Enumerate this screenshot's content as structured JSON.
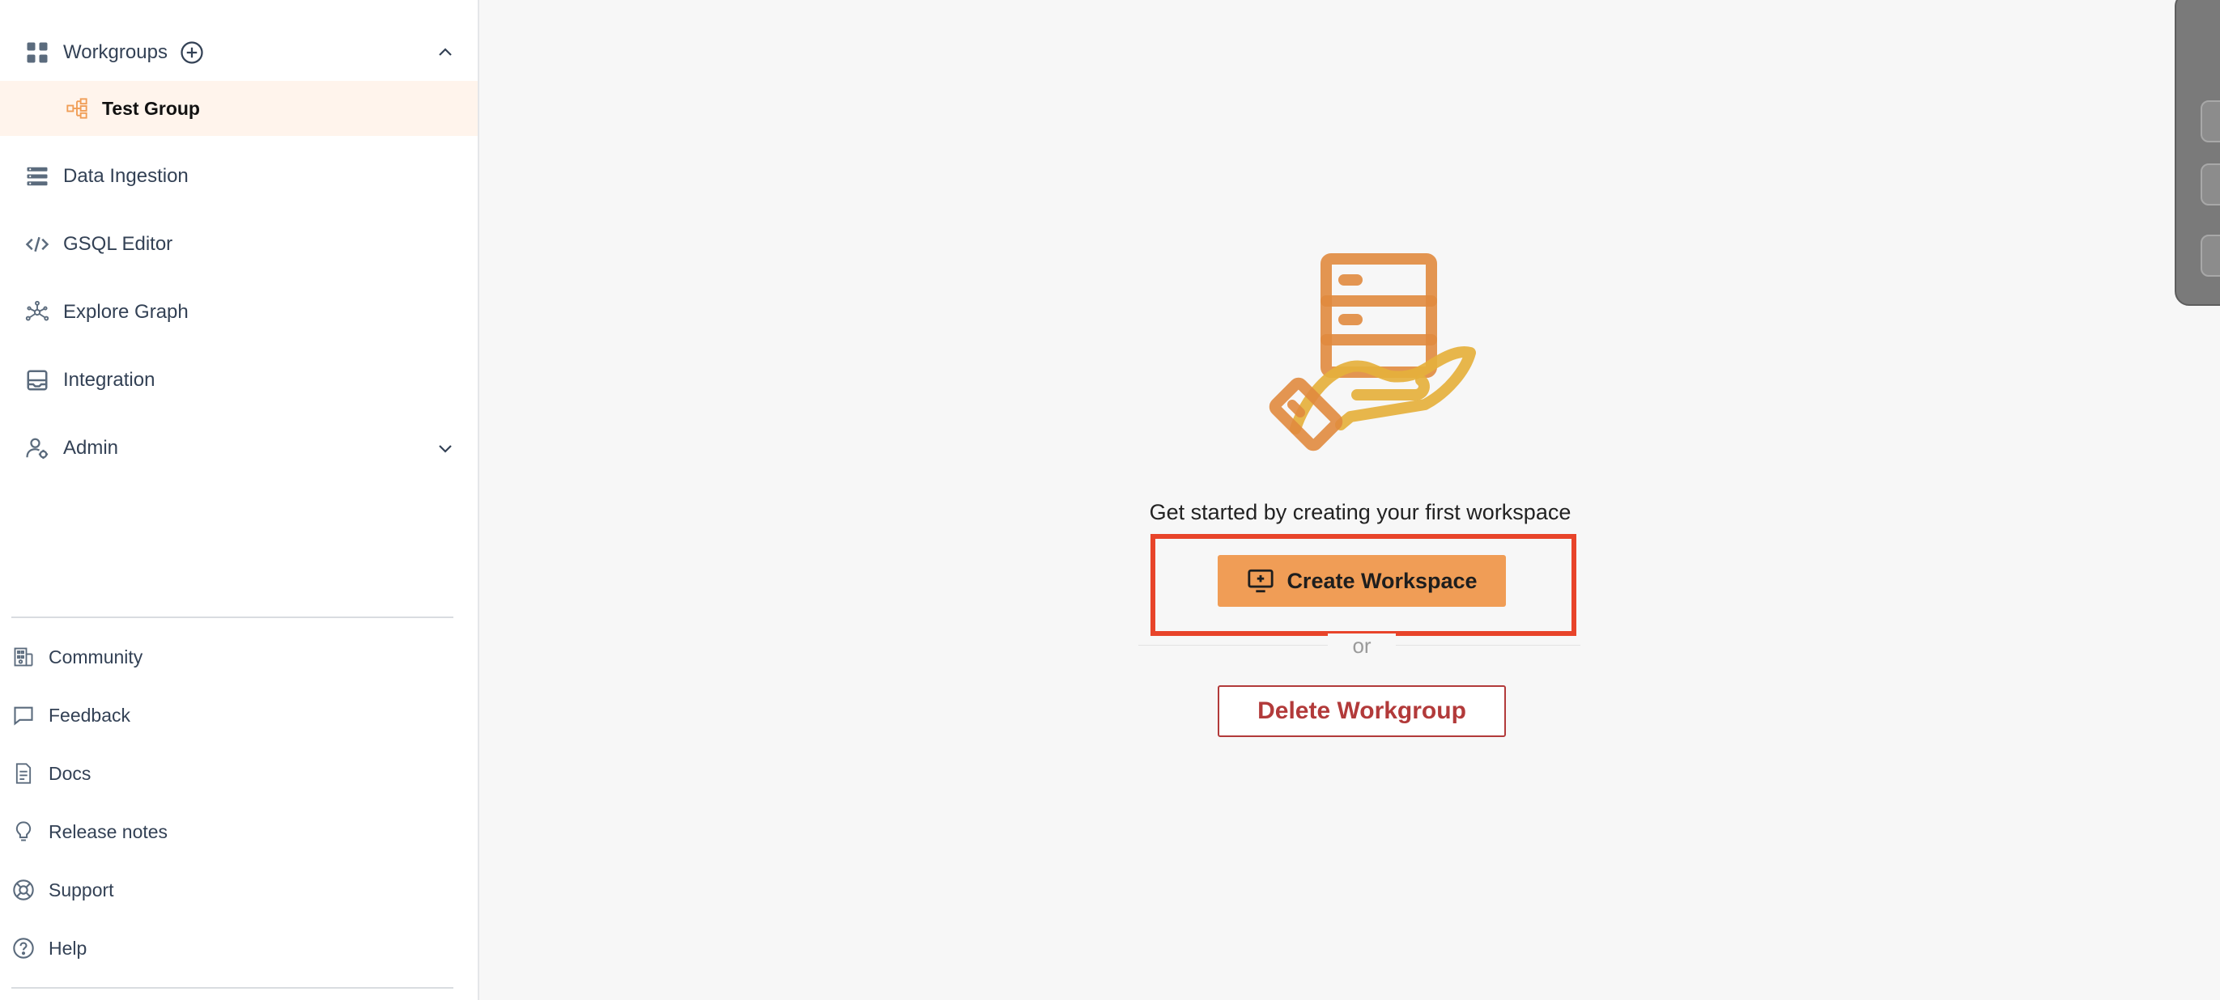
{
  "sidebar": {
    "workgroups": {
      "label": "Workgroups",
      "items": [
        {
          "label": "Test Group"
        }
      ]
    },
    "nav": [
      {
        "label": "Data Ingestion",
        "icon": "data-ingestion-icon"
      },
      {
        "label": "GSQL Editor",
        "icon": "code-icon"
      },
      {
        "label": "Explore Graph",
        "icon": "graph-icon"
      },
      {
        "label": "Integration",
        "icon": "integration-icon"
      },
      {
        "label": "Admin",
        "icon": "admin-icon"
      }
    ],
    "footer": [
      {
        "label": "Community",
        "icon": "community-icon"
      },
      {
        "label": "Feedback",
        "icon": "feedback-icon"
      },
      {
        "label": "Docs",
        "icon": "docs-icon"
      },
      {
        "label": "Release notes",
        "icon": "lightbulb-icon"
      },
      {
        "label": "Support",
        "icon": "support-icon"
      },
      {
        "label": "Help",
        "icon": "help-icon"
      }
    ]
  },
  "main": {
    "empty_message": "Get started by creating your first workspace",
    "create_button": "Create Workspace",
    "or_text": "or",
    "delete_button": "Delete Workgroup"
  },
  "colors": {
    "accent": "#f09d56",
    "danger": "#b23a3a",
    "highlight": "#e8442a",
    "selected_bg": "#fff4ec"
  }
}
